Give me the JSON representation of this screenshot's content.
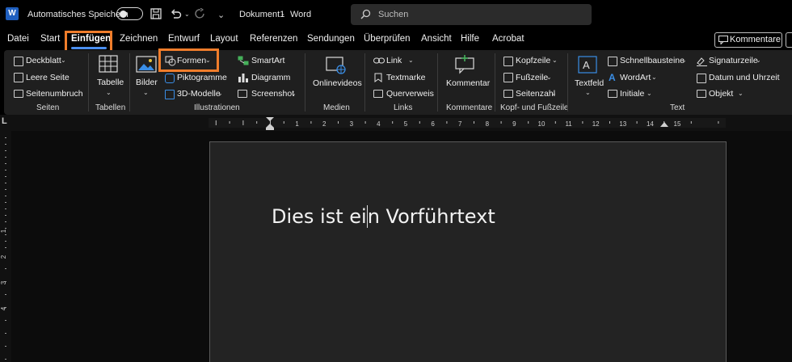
{
  "titlebar": {
    "autosave_label": "Automatisches Speichern",
    "doc_name": "Dokument1",
    "app_separator": "-",
    "app_name": "Word",
    "search_placeholder": "Suchen"
  },
  "tabs": [
    "Datei",
    "Start",
    "Einfügen",
    "Zeichnen",
    "Entwurf",
    "Layout",
    "Referenzen",
    "Sendungen",
    "Überprüfen",
    "Ansicht",
    "Hilfe",
    "Acrobat"
  ],
  "active_tab": "Einfügen",
  "comments_button": "Kommentare",
  "ribbon": {
    "seiten": {
      "items": [
        "Deckblatt",
        "Leere Seite",
        "Seitenumbruch"
      ],
      "label": "Seiten"
    },
    "tabellen": {
      "item": "Tabelle",
      "label": "Tabellen"
    },
    "illustrationen": {
      "bilder": "Bilder",
      "formen": "Formen",
      "piktogramme": "Piktogramme",
      "modelle": "3D-Modelle",
      "smartart": "SmartArt",
      "diagramm": "Diagramm",
      "screenshot": "Screenshot",
      "label": "Illustrationen"
    },
    "medien": {
      "item": "Onlinevideos",
      "label": "Medien"
    },
    "links": {
      "items": [
        "Link",
        "Textmarke",
        "Querverweis"
      ],
      "label": "Links"
    },
    "kommentare": {
      "item": "Kommentar",
      "label": "Kommentare"
    },
    "kopf": {
      "items": [
        "Kopfzeile",
        "Fußzeile",
        "Seitenzahl"
      ],
      "label": "Kopf- und Fußzeile"
    },
    "text": {
      "textfeld": "Textfeld",
      "schnellbausteine": "Schnellbausteine",
      "wordart": "WordArt",
      "initiale": "Initiale",
      "signaturzeile": "Signaturzeile",
      "datum": "Datum und Uhrzeit",
      "objekt": "Objekt",
      "label": "Text"
    }
  },
  "ruler_numbers": [
    "1",
    "2",
    "3",
    "4",
    "5",
    "6",
    "7",
    "8",
    "9",
    "10",
    "11",
    "12",
    "13",
    "14",
    "15"
  ],
  "left_ruler_numbers": [
    "1",
    "2",
    "3",
    "4"
  ],
  "document": {
    "text_before_cursor": "Dies ist ei",
    "text_after_cursor": "n Vorführtext"
  },
  "colors": {
    "highlight": "#f07d2b",
    "tab_underline": "#4a8ff0",
    "word_blue": "#1f5fbf"
  }
}
